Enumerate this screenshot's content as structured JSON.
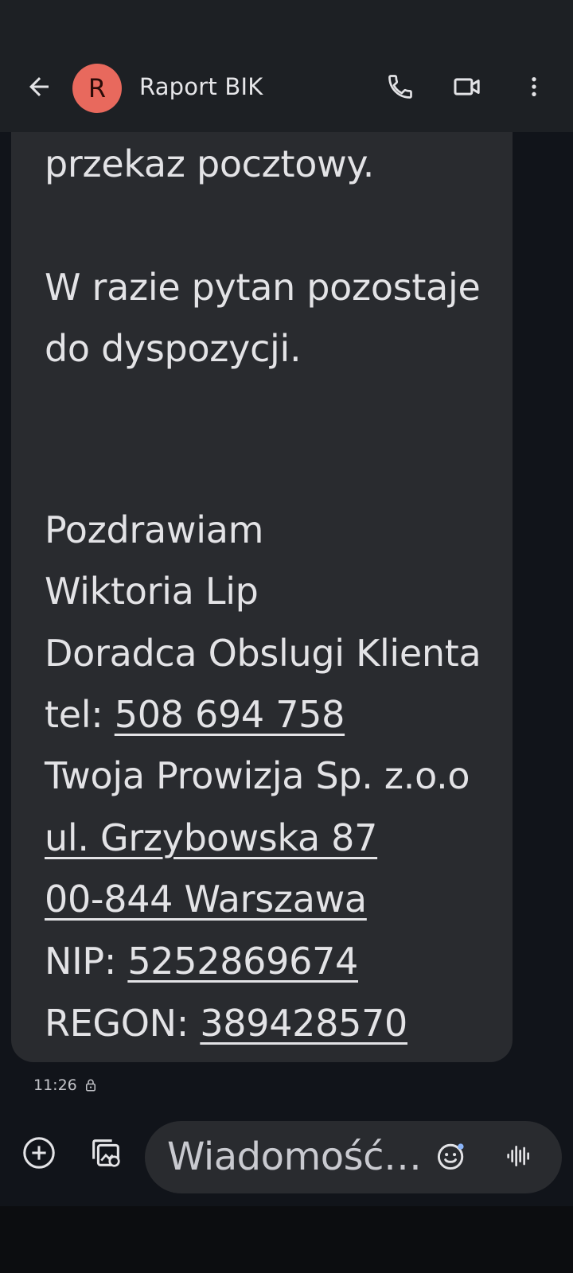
{
  "header": {
    "avatar_letter": "R",
    "contact_name": "Raport BIK",
    "icons": [
      "arrow-back-icon",
      "phone-icon",
      "videocam-icon",
      "more-vert-icon"
    ]
  },
  "message": {
    "lines": [
      "przekaz pocztowy.",
      "W razie pytan pozostaje",
      "do dyspozycji.",
      "Pozdrawiam",
      "Wiktoria Lip",
      "Doradca Obslugi Klienta"
    ],
    "tel_label": "tel: ",
    "tel_value": "508 694 758",
    "company": "Twoja Prowizja Sp. z.o.o",
    "street": "ul. Grzybowska 87",
    "city": "00-844 Warszawa",
    "nip_label": "NIP: ",
    "nip_value": "5252869674",
    "regon_label": "REGON: ",
    "regon_value": "389428570",
    "timestamp": "11:26"
  },
  "compose": {
    "placeholder": "Wiadomość…",
    "icons": [
      "add-icon",
      "gallery-icon",
      "emoji-icon",
      "voice-icon"
    ]
  },
  "colors": {
    "background": "#11141a",
    "bubble": "#292b2f",
    "avatar": "#e8695d"
  }
}
